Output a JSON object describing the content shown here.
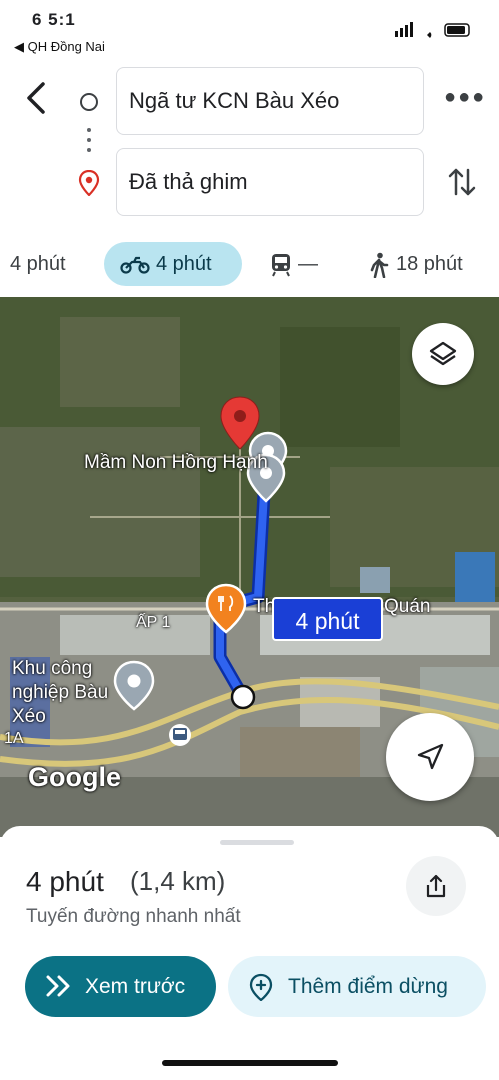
{
  "status_bar": {
    "time": "6 5:1",
    "back_app": "◀ QH Đồng Nai",
    "right_icons": "signal wifi battery"
  },
  "header": {
    "origin_value": "Ngã tư KCN Bàu Xéo",
    "destination_value": "Đã thả ghim",
    "back_icon": "chevron-left-icon",
    "more_icon": "more-horizontal-icon",
    "swap_icon": "swap-vertical-icon"
  },
  "modes": {
    "drive": "4 phút",
    "motorbike": "4 phút",
    "transit": "—",
    "walk": "18 phút",
    "selected": "motorbike"
  },
  "map": {
    "labels": {
      "kindergarten": "Mầm Non Hồng Hạnh",
      "hamlet": "ẤP 1",
      "restaurant": "Th",
      "restaurant_end": "Quán",
      "industrial_zone": "Khu công nghiệp Bàu Xéo",
      "road": "1A"
    },
    "eta": "4 phút",
    "logo": "Google",
    "route_color": "#1a4be0"
  },
  "sheet": {
    "time": "4 phút",
    "distance": "(1,4 km)",
    "subtitle": "Tuyến đường nhanh nhất",
    "preview_label": "Xem trước",
    "add_stop_label": "Thêm điểm dừng"
  }
}
